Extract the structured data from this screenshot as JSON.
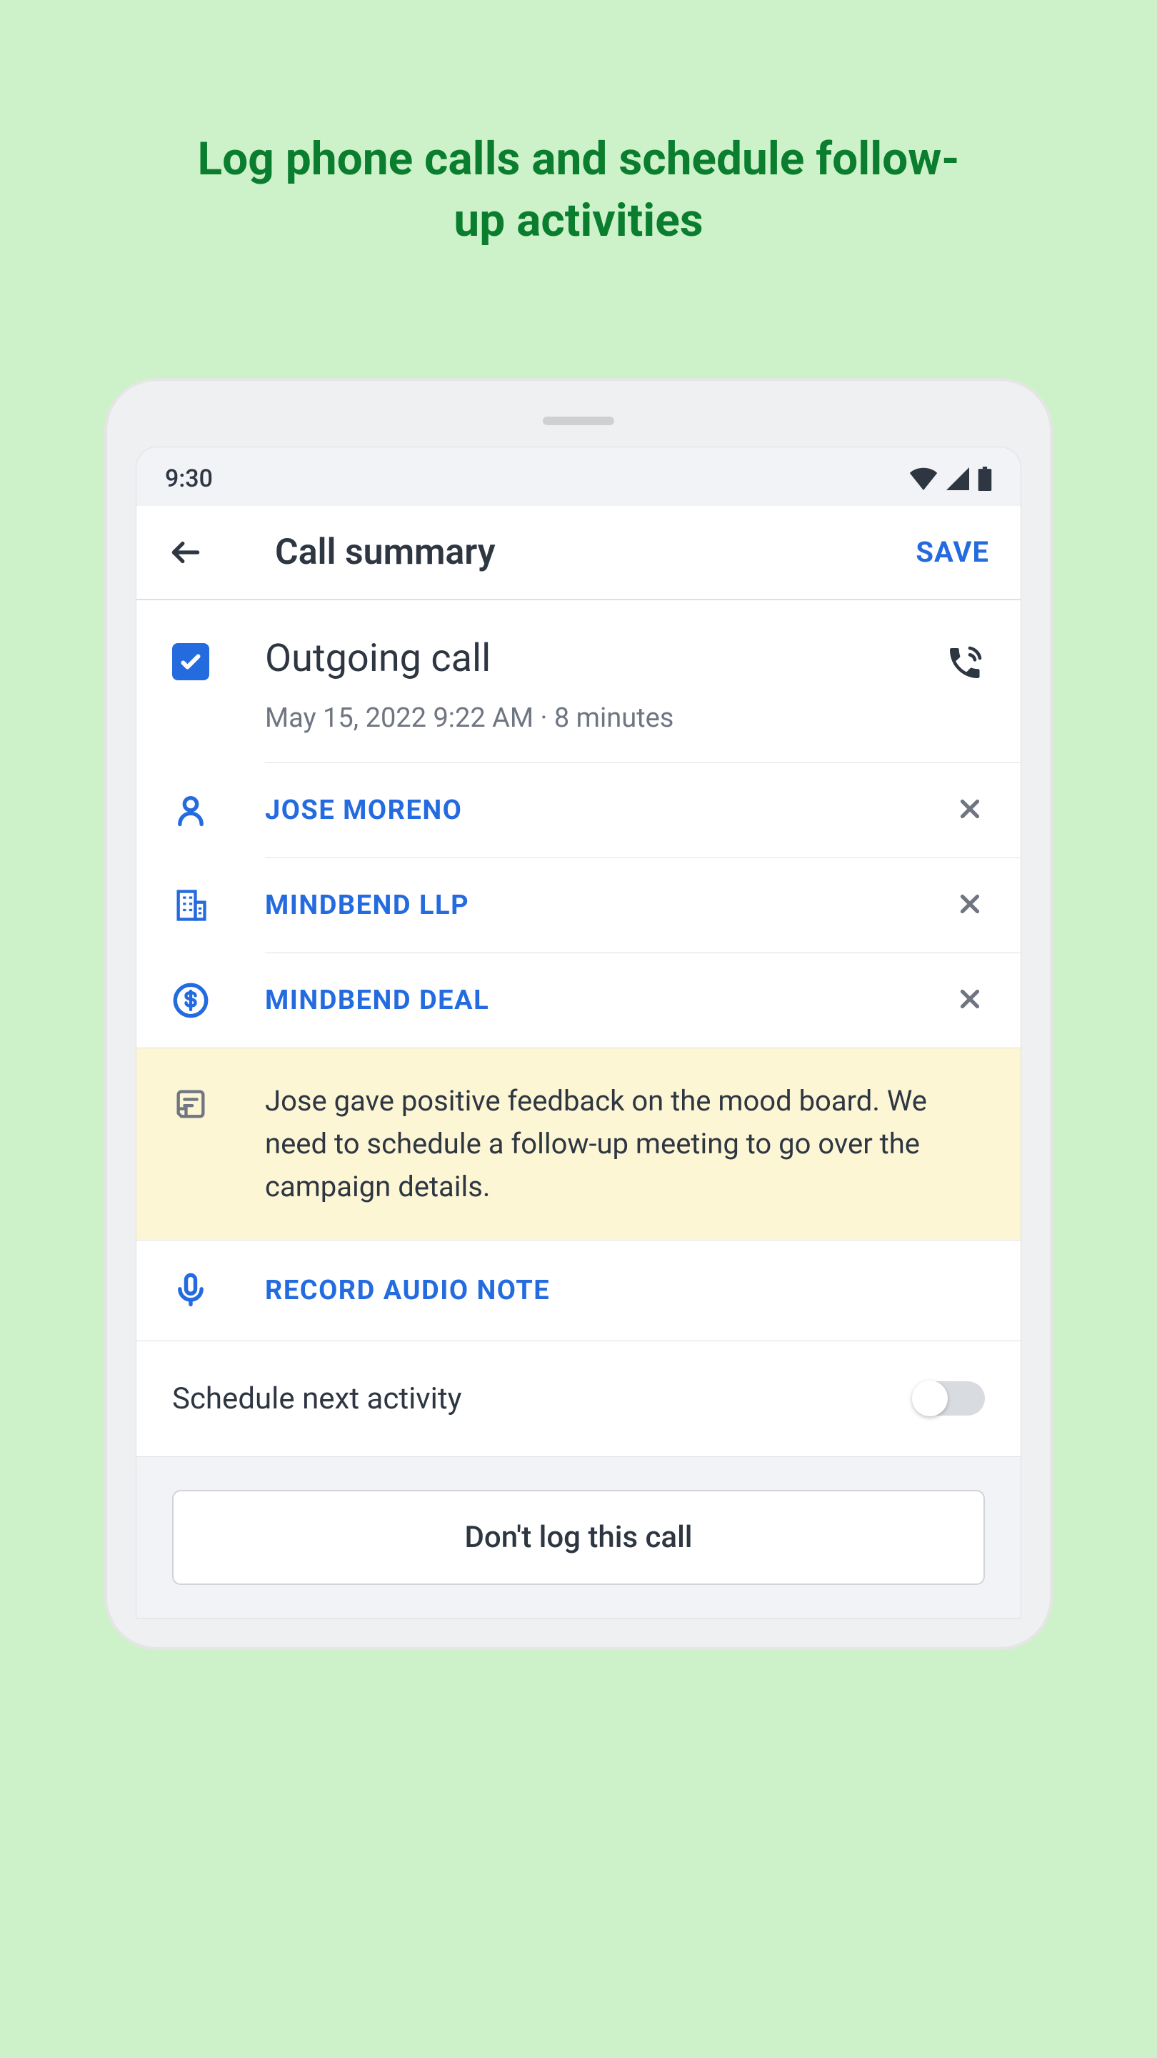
{
  "marketing": {
    "title": "Log phone calls and schedule follow-up activities"
  },
  "statusBar": {
    "time": "9:30"
  },
  "header": {
    "title": "Call summary",
    "saveLabel": "SAVE"
  },
  "call": {
    "type": "Outgoing call",
    "timestamp": "May 15, 2022 9:22 AM · 8 minutes"
  },
  "links": {
    "contact": "JOSE MORENO",
    "company": "MINDBEND LLP",
    "deal": "MINDBEND DEAL"
  },
  "note": {
    "text": "Jose gave positive feedback on the mood board. We need to schedule a follow-up meeting to go over the campaign details."
  },
  "audio": {
    "label": "RECORD AUDIO NOTE"
  },
  "schedule": {
    "label": "Schedule next activity",
    "enabled": false
  },
  "footer": {
    "dontLogLabel": "Don't log this call"
  }
}
